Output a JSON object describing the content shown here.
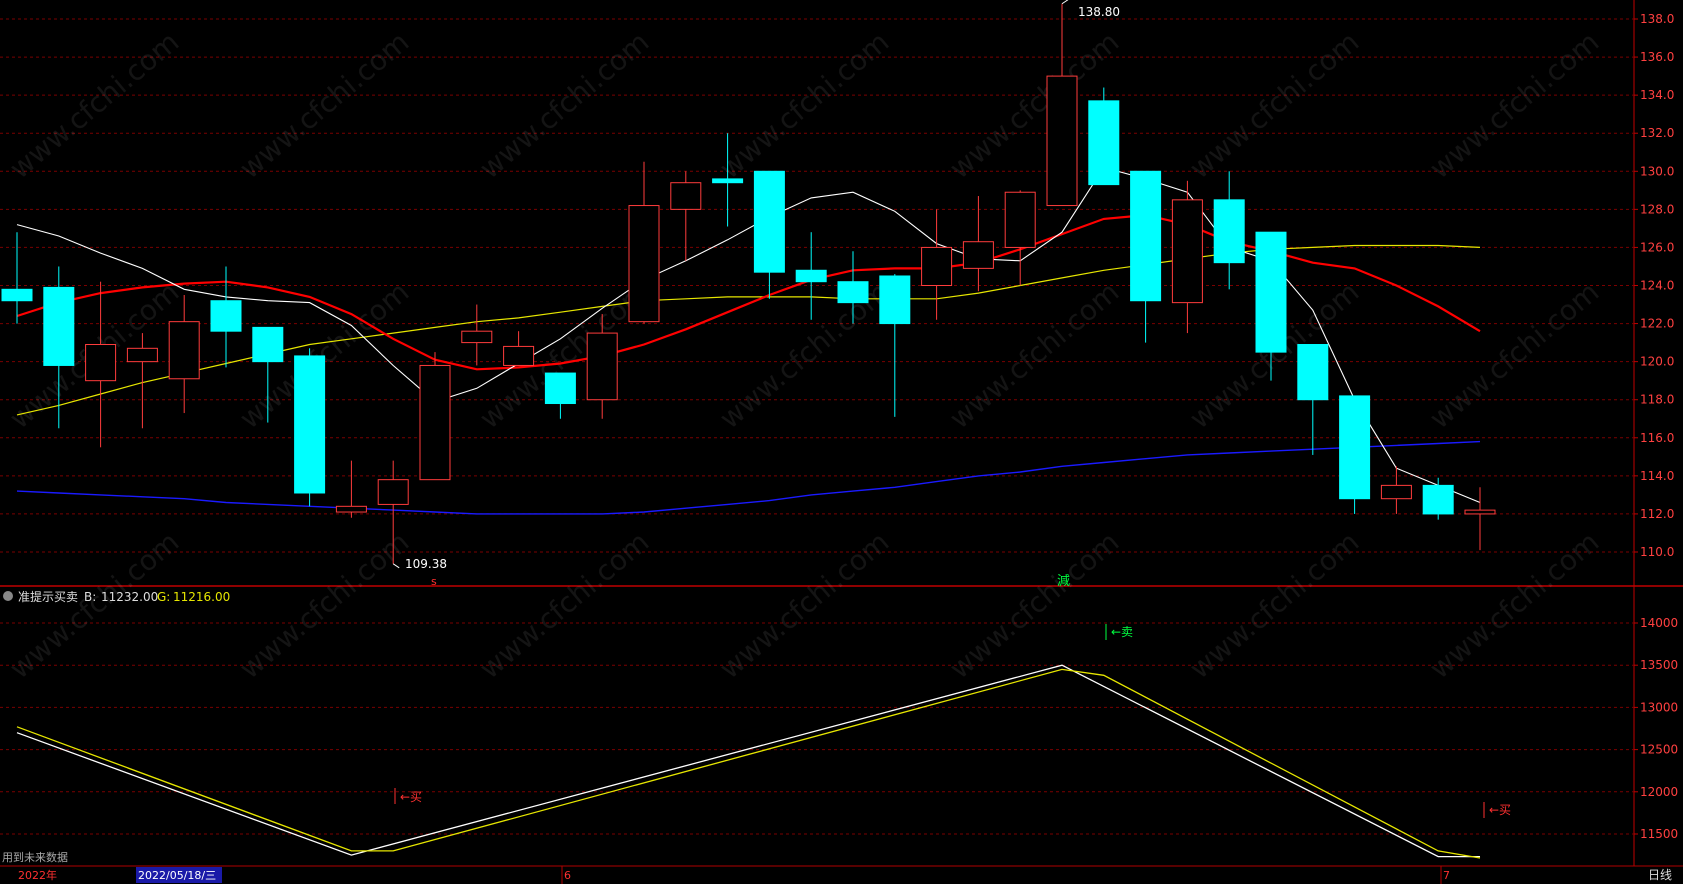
{
  "watermark": "www.cfchi.com",
  "main_panel": {
    "high_annotation": "138.80",
    "low_annotation": "109.38",
    "buy_signal_glyph": "s",
    "sell_signal_glyph": "減"
  },
  "indicator_panel": {
    "name": "准提示买卖",
    "b_label": "B:",
    "b_value": "11232.00",
    "g_label": "G:",
    "g_value": "11216.00",
    "sell_marker": "←卖",
    "buy_marker": "←买",
    "future_data_note": "用到未来数据"
  },
  "time_axis": {
    "year_label": "2022年",
    "selected_date": "2022/05/18/三",
    "month_label_1": "6",
    "month_label_2": "7",
    "period_button": "日线"
  },
  "colors": {
    "up_candle": "#ff3c3c",
    "down_candle": "#00ffff",
    "ma5": "#ffffff",
    "ma10": "#ff0000",
    "ma20": "#e6e600",
    "ma60": "#1a1aff",
    "grid": "#7a0000",
    "axis_text": "#ff4040"
  },
  "chart_data": [
    {
      "type": "candlestick",
      "title": "",
      "ylim": [
        109,
        139
      ],
      "y_ticks": [
        "110.0",
        "112.0",
        "114.0",
        "116.0",
        "118.0",
        "120.0",
        "122.0",
        "124.0",
        "126.0",
        "128.0",
        "130.0",
        "132.0",
        "134.0",
        "136.0",
        "138.0"
      ],
      "candles": [
        {
          "o": 123.8,
          "c": 123.2,
          "h": 126.8,
          "l": 122.0
        },
        {
          "o": 123.9,
          "c": 119.8,
          "h": 125.0,
          "l": 116.5
        },
        {
          "o": 119.0,
          "c": 120.9,
          "h": 124.2,
          "l": 115.5
        },
        {
          "o": 120.0,
          "c": 120.7,
          "h": 121.5,
          "l": 116.5
        },
        {
          "o": 119.1,
          "c": 122.1,
          "h": 123.5,
          "l": 117.3
        },
        {
          "o": 123.2,
          "c": 121.6,
          "h": 125.0,
          "l": 119.7
        },
        {
          "o": 121.8,
          "c": 120.0,
          "h": 121.8,
          "l": 116.8
        },
        {
          "o": 120.3,
          "c": 113.1,
          "h": 120.7,
          "l": 112.4
        },
        {
          "o": 112.1,
          "c": 112.4,
          "h": 114.8,
          "l": 111.8
        },
        {
          "o": 112.5,
          "c": 113.8,
          "h": 114.8,
          "l": 109.38
        },
        {
          "o": 113.8,
          "c": 119.8,
          "h": 120.5,
          "l": 113.8
        },
        {
          "o": 121.0,
          "c": 121.6,
          "h": 123.0,
          "l": 119.8
        },
        {
          "o": 119.8,
          "c": 120.8,
          "h": 121.6,
          "l": 119.8
        },
        {
          "o": 119.4,
          "c": 117.8,
          "h": 119.4,
          "l": 117.0
        },
        {
          "o": 118.0,
          "c": 121.5,
          "h": 122.5,
          "l": 117.0
        },
        {
          "o": 122.1,
          "c": 128.2,
          "h": 130.5,
          "l": 122.0
        },
        {
          "o": 128.0,
          "c": 129.4,
          "h": 130.0,
          "l": 125.3
        },
        {
          "o": 129.6,
          "c": 129.4,
          "h": 132.0,
          "l": 127.1
        },
        {
          "o": 130.0,
          "c": 124.7,
          "h": 130.0,
          "l": 123.3
        },
        {
          "o": 124.8,
          "c": 124.2,
          "h": 126.8,
          "l": 122.2
        },
        {
          "o": 124.2,
          "c": 123.1,
          "h": 125.8,
          "l": 122.0
        },
        {
          "o": 124.5,
          "c": 122.0,
          "h": 124.6,
          "l": 117.1
        },
        {
          "o": 124.0,
          "c": 126.0,
          "h": 128.0,
          "l": 122.2
        },
        {
          "o": 124.9,
          "c": 126.3,
          "h": 128.7,
          "l": 123.7
        },
        {
          "o": 126.0,
          "c": 128.9,
          "h": 129.0,
          "l": 124.0
        },
        {
          "o": 128.2,
          "c": 135.0,
          "h": 138.8,
          "l": 128.2
        },
        {
          "o": 133.7,
          "c": 129.3,
          "h": 134.4,
          "l": 129.3
        },
        {
          "o": 130.0,
          "c": 123.2,
          "h": 130.0,
          "l": 121.0
        },
        {
          "o": 123.1,
          "c": 128.5,
          "h": 129.5,
          "l": 121.5
        },
        {
          "o": 128.5,
          "c": 125.2,
          "h": 130.0,
          "l": 123.8
        },
        {
          "o": 126.8,
          "c": 120.5,
          "h": 126.8,
          "l": 119.0
        },
        {
          "o": 120.9,
          "c": 118.0,
          "h": 120.9,
          "l": 115.1
        },
        {
          "o": 118.2,
          "c": 112.8,
          "h": 118.2,
          "l": 112.0
        },
        {
          "o": 112.8,
          "c": 113.5,
          "h": 114.5,
          "l": 112.0
        },
        {
          "o": 113.5,
          "c": 112.0,
          "h": 113.9,
          "l": 111.7
        },
        {
          "o": 112.0,
          "c": 112.2,
          "h": 113.4,
          "l": 110.1
        }
      ],
      "ma5": [
        127.2,
        126.6,
        125.7,
        124.9,
        123.8,
        123.4,
        123.2,
        123.1,
        121.9,
        119.8,
        117.9,
        118.6,
        119.9,
        121.2,
        122.8,
        124.3,
        125.3,
        126.4,
        127.6,
        128.6,
        128.9,
        127.9,
        126.2,
        125.4,
        125.3,
        126.8,
        130.2,
        129.6,
        128.9,
        126.0,
        125.3,
        122.7,
        118.0,
        114.4,
        113.5,
        112.6
      ],
      "ma10": [
        122.4,
        123.1,
        123.6,
        123.9,
        124.1,
        124.2,
        123.9,
        123.4,
        122.5,
        121.2,
        120.1,
        119.6,
        119.7,
        119.9,
        120.3,
        120.9,
        121.7,
        122.6,
        123.5,
        124.3,
        124.8,
        124.9,
        124.9,
        125.2,
        125.9,
        126.7,
        127.5,
        127.7,
        127.2,
        126.3,
        125.8,
        125.2,
        124.9,
        124.0,
        122.9,
        121.6
      ],
      "ma20": [
        117.2,
        117.7,
        118.3,
        118.9,
        119.4,
        119.9,
        120.4,
        120.9,
        121.2,
        121.5,
        121.8,
        122.1,
        122.3,
        122.6,
        122.9,
        123.2,
        123.3,
        123.4,
        123.4,
        123.4,
        123.3,
        123.3,
        123.3,
        123.6,
        124.0,
        124.4,
        124.8,
        125.1,
        125.4,
        125.7,
        125.9,
        126.0,
        126.1,
        126.1,
        126.1,
        126.0
      ],
      "ma60": [
        113.2,
        113.1,
        113.0,
        112.9,
        112.8,
        112.6,
        112.5,
        112.4,
        112.3,
        112.2,
        112.1,
        112.0,
        112.0,
        112.0,
        112.0,
        112.1,
        112.3,
        112.5,
        112.7,
        113.0,
        113.2,
        113.4,
        113.7,
        114.0,
        114.2,
        114.5,
        114.7,
        114.9,
        115.1,
        115.2,
        115.3,
        115.4,
        115.5,
        115.6,
        115.7,
        115.8
      ]
    },
    {
      "type": "line",
      "title": "准提示买卖",
      "ylim": [
        11200,
        14300
      ],
      "y_ticks": [
        "11500",
        "12000",
        "12500",
        "13000",
        "13500",
        "14000"
      ],
      "series": [
        {
          "name": "B",
          "color": "#ffffff",
          "points": [
            [
              0,
              12700
            ],
            [
              8,
              11250
            ],
            [
              25,
              13500
            ],
            [
              34,
              11232
            ],
            [
              35,
              11232
            ]
          ]
        },
        {
          "name": "G",
          "color": "#e6e600",
          "points": [
            [
              0,
              12770
            ],
            [
              8,
              11300
            ],
            [
              9,
              11300
            ],
            [
              25,
              13450
            ],
            [
              26,
              13380
            ],
            [
              34,
              11300
            ],
            [
              35,
              11216
            ]
          ]
        }
      ]
    }
  ]
}
